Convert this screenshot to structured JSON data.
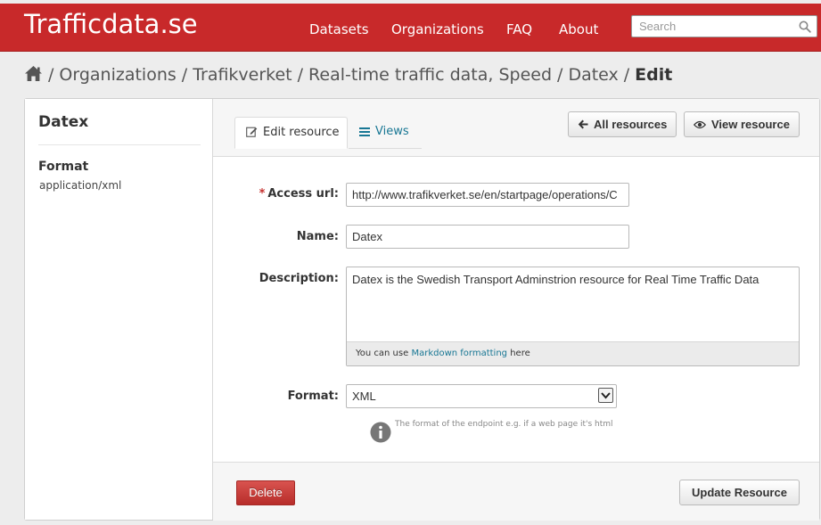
{
  "colors": {
    "brand_red": "#c8292a",
    "link_blue": "#187794",
    "delete_red": "#c6302e"
  },
  "header": {
    "brand": "Trafficdata.se",
    "nav": [
      "Datasets",
      "Organizations",
      "FAQ",
      "About"
    ],
    "search_placeholder": "Search"
  },
  "breadcrumb": {
    "home_icon": "home-icon",
    "items": [
      "Organizations",
      "Trafikverket",
      "Real-time traffic data, Speed",
      "Datex"
    ],
    "active": "Edit"
  },
  "sidebar": {
    "title": "Datex",
    "format_label": "Format",
    "format_value": "application/xml"
  },
  "tabs": {
    "edit": "Edit resource",
    "views": "Views"
  },
  "actions": {
    "all_resources": "All resources",
    "view_resource": "View resource"
  },
  "form": {
    "required_mark": "*",
    "access_url_label": "Access url:",
    "access_url_value": "http://www.trafikverket.se/en/startpage/operations/C",
    "name_label": "Name:",
    "name_value": "Datex",
    "description_label": "Description:",
    "description_value": "Datex is the Swedish Transport Adminstrion resource for Real Time Traffic Data",
    "markdown_prefix": "You can use",
    "markdown_link": "Markdown formatting",
    "markdown_suffix": "here",
    "format_label": "Format:",
    "format_value": "XML",
    "format_hint": "The format of the endpoint e.g. if a web page it's html"
  },
  "footer": {
    "delete": "Delete",
    "update": "Update Resource"
  }
}
